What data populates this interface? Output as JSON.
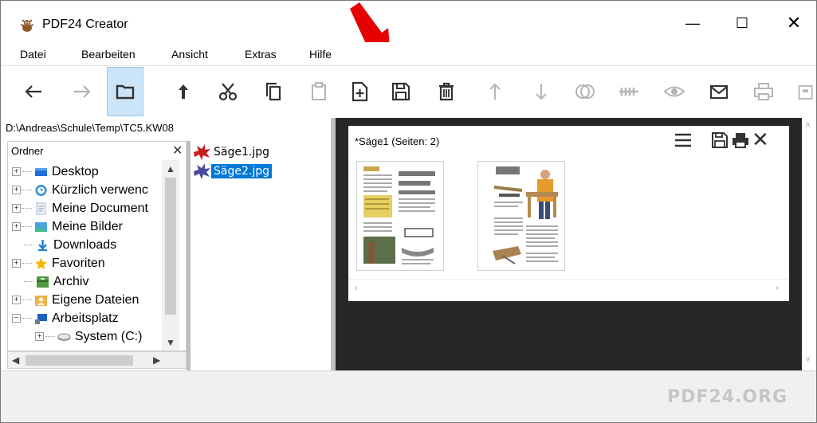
{
  "window": {
    "title": "PDF24 Creator",
    "minimize_glyph": "—",
    "maximize_glyph": "☐",
    "close_glyph": "✕"
  },
  "menu": [
    "Datei",
    "Bearbeiten",
    "Ansicht",
    "Extras",
    "Hilfe"
  ],
  "toolbar": {
    "buttons": [
      {
        "name": "back-arrow-icon",
        "enabled": true
      },
      {
        "name": "forward-arrow-icon",
        "enabled": false
      },
      {
        "name": "folder-icon",
        "enabled": true,
        "active": true
      },
      {
        "name": "up-arrow-icon",
        "enabled": true
      },
      {
        "name": "scissors-icon",
        "enabled": true
      },
      {
        "name": "copy-icon",
        "enabled": true
      },
      {
        "name": "paste-icon",
        "enabled": false
      },
      {
        "name": "new-document-icon",
        "enabled": true
      },
      {
        "name": "save-icon",
        "enabled": true
      },
      {
        "name": "delete-icon",
        "enabled": true
      },
      {
        "name": "move-up-icon",
        "enabled": false
      },
      {
        "name": "move-down-icon",
        "enabled": false
      },
      {
        "name": "merge-icon",
        "enabled": false
      },
      {
        "name": "compress-icon",
        "enabled": false
      },
      {
        "name": "preview-eye-icon",
        "enabled": false
      },
      {
        "name": "email-icon",
        "enabled": true
      },
      {
        "name": "print-icon",
        "enabled": false
      },
      {
        "name": "fax-icon",
        "enabled": false
      }
    ],
    "colors": {
      "enabled": "#333333",
      "disabled": "#b5b5b5",
      "active_bg": "#cce4f7"
    }
  },
  "path": "D:\\Andreas\\Schule\\Temp\\TC5.KW08",
  "folder_pane": {
    "header": "Ordner",
    "close_glyph": "✕",
    "tree": [
      {
        "label": "Desktop",
        "icon": "desktop-icon",
        "expander": "+",
        "level": 0
      },
      {
        "label": "Kürzlich verwenc",
        "icon": "recent-icon",
        "expander": "+",
        "level": 0
      },
      {
        "label": "Meine Document",
        "icon": "documents-icon",
        "expander": "+",
        "level": 0
      },
      {
        "label": "Meine Bilder",
        "icon": "pictures-icon",
        "expander": "+",
        "level": 0
      },
      {
        "label": "Downloads",
        "icon": "downloads-icon",
        "expander": "",
        "level": 0
      },
      {
        "label": "Favoriten",
        "icon": "star-icon",
        "expander": "+",
        "level": 0
      },
      {
        "label": "Archiv",
        "icon": "archive-icon",
        "expander": "",
        "level": 0
      },
      {
        "label": "Eigene Dateien",
        "icon": "user-files-icon",
        "expander": "+",
        "level": 0
      },
      {
        "label": "Arbeitsplatz",
        "icon": "computer-icon",
        "expander": "−",
        "level": 0
      },
      {
        "label": "System (C:)",
        "icon": "drive-icon",
        "expander": "+",
        "level": 1
      }
    ]
  },
  "files": [
    {
      "name": "Säge1.jpg",
      "selected": false
    },
    {
      "name": "Säge2.jpg",
      "selected": true
    }
  ],
  "document": {
    "title": "*Säge1 (Seiten: 2)",
    "pages": 2
  },
  "footer": {
    "brand": "PDF24.ORG"
  },
  "annotation": {
    "arrow_color": "#e60000",
    "target": "save-icon"
  }
}
